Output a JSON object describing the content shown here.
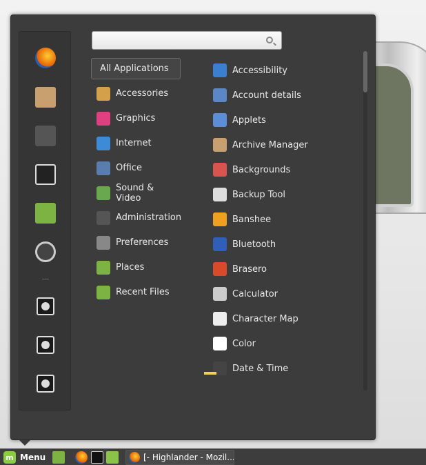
{
  "search": {
    "placeholder": "",
    "value": ""
  },
  "favorites": [
    {
      "name": "firefox",
      "icon": "firefox-icon",
      "color": "#e66000"
    },
    {
      "name": "software-manager",
      "icon": "package-icon",
      "color": "#c8a070"
    },
    {
      "name": "system-settings",
      "icon": "settings-icon",
      "color": "#555555"
    },
    {
      "name": "terminal",
      "icon": "terminal-icon",
      "color": "#222222"
    },
    {
      "name": "files",
      "icon": "folder-icon",
      "color": "#7cb342"
    },
    {
      "name": "camera",
      "icon": "camera-icon",
      "color": "#444444"
    }
  ],
  "system_buttons": [
    {
      "name": "lock",
      "icon": "lock-icon"
    },
    {
      "name": "logout",
      "icon": "logout-icon"
    },
    {
      "name": "shutdown",
      "icon": "power-icon"
    }
  ],
  "categories": [
    {
      "label": "All Applications",
      "icon": "",
      "color": ""
    },
    {
      "label": "Accessories",
      "icon": "calculator-icon",
      "color": "#d4a04a"
    },
    {
      "label": "Graphics",
      "icon": "palette-icon",
      "color": "#e04080"
    },
    {
      "label": "Internet",
      "icon": "internet-icon",
      "color": "#3d8bd6"
    },
    {
      "label": "Office",
      "icon": "office-icon",
      "color": "#5a7db0"
    },
    {
      "label": "Sound & Video",
      "icon": "media-icon",
      "color": "#6aa84f"
    },
    {
      "label": "Administration",
      "icon": "admin-icon",
      "color": "#555555"
    },
    {
      "label": "Preferences",
      "icon": "preferences-icon",
      "color": "#888888"
    },
    {
      "label": "Places",
      "icon": "folder-icon",
      "color": "#7cb342"
    },
    {
      "label": "Recent Files",
      "icon": "recent-folder-icon",
      "color": "#7cb342"
    }
  ],
  "apps": [
    {
      "label": "Accessibility",
      "icon": "accessibility-icon",
      "color": "#3b7fd0"
    },
    {
      "label": "Account details",
      "icon": "user-icon",
      "color": "#5b87c4"
    },
    {
      "label": "Applets",
      "icon": "applets-icon",
      "color": "#5b8ed6"
    },
    {
      "label": "Archive Manager",
      "icon": "archive-icon",
      "color": "#c8a070"
    },
    {
      "label": "Backgrounds",
      "icon": "backgrounds-icon",
      "color": "#d9534f"
    },
    {
      "label": "Backup Tool",
      "icon": "backup-icon",
      "color": "#dddddd"
    },
    {
      "label": "Banshee",
      "icon": "banshee-icon",
      "color": "#f0a020"
    },
    {
      "label": "Bluetooth",
      "icon": "bluetooth-icon",
      "color": "#2f5fb8"
    },
    {
      "label": "Brasero",
      "icon": "disc-icon",
      "color": "#d84a2a"
    },
    {
      "label": "Calculator",
      "icon": "calculator-icon",
      "color": "#cccccc"
    },
    {
      "label": "Character Map",
      "icon": "charmap-icon",
      "color": "#eeeeee"
    },
    {
      "label": "Color",
      "icon": "color-icon",
      "color": "#ffffff"
    },
    {
      "label": "Date & Time",
      "icon": "clock-icon",
      "color": "#444444"
    }
  ],
  "taskbar": {
    "menu_label": "Menu",
    "window_title": "[- Highlander - Mozil..."
  }
}
